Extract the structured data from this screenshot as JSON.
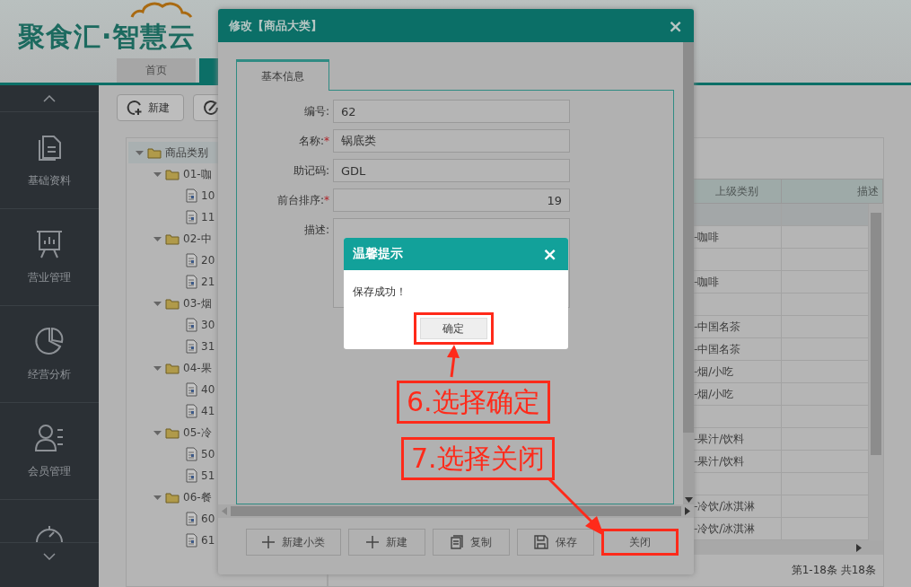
{
  "header": {
    "logo": "聚食汇·智慧云",
    "tabs": [
      {
        "label": "首页",
        "selected": false
      },
      {
        "selected": true
      }
    ]
  },
  "sidebar": {
    "items": [
      {
        "label": "基础资料",
        "kind": "files"
      },
      {
        "label": "营业管理",
        "kind": "board"
      },
      {
        "label": "经营分析",
        "kind": "pie"
      },
      {
        "label": "会员管理",
        "kind": "member"
      }
    ]
  },
  "toolbar": {
    "new_button": "新建"
  },
  "tree": {
    "label": "商品类别",
    "selected": true,
    "expanded": true,
    "children": [
      {
        "label": "01-咖",
        "selected": false,
        "expanded": true,
        "children": [
          {
            "label": "10",
            "selected": false
          },
          {
            "label": "11",
            "selected": false
          }
        ]
      },
      {
        "label": "02-中",
        "selected": false,
        "expanded": true,
        "children": [
          {
            "label": "20",
            "selected": false
          },
          {
            "label": "21",
            "selected": false
          }
        ]
      },
      {
        "label": "03-烟",
        "selected": false,
        "expanded": true,
        "children": [
          {
            "label": "30",
            "selected": false
          },
          {
            "label": "31",
            "selected": false
          }
        ]
      },
      {
        "label": "04-果",
        "selected": false,
        "expanded": true,
        "children": [
          {
            "label": "40",
            "selected": false
          },
          {
            "label": "41",
            "selected": false
          }
        ]
      },
      {
        "label": "05-冷",
        "selected": false,
        "expanded": true,
        "children": [
          {
            "label": "50",
            "selected": false
          },
          {
            "label": "51",
            "selected": false
          }
        ]
      },
      {
        "label": "06-餐",
        "selected": false,
        "expanded": true,
        "children": [
          {
            "label": "60",
            "selected": false
          },
          {
            "label": "61",
            "selected": false
          }
        ]
      }
    ]
  },
  "grid": {
    "columns": [
      "上级类别",
      "描述"
    ],
    "rows": [
      {
        "parent": "",
        "selected": true
      },
      {
        "parent": "-咖啡",
        "selected": false
      },
      {
        "parent": "",
        "selected": false
      },
      {
        "parent": "-咖啡",
        "selected": false
      },
      {
        "parent": "",
        "selected": false
      },
      {
        "parent": "-中国名茶",
        "selected": false
      },
      {
        "parent": "-中国名茶",
        "selected": false
      },
      {
        "parent": "-烟/小吃",
        "selected": false
      },
      {
        "parent": "-烟/小吃",
        "selected": false
      },
      {
        "parent": "",
        "selected": false
      },
      {
        "parent": "-果汁/饮料",
        "selected": false
      },
      {
        "parent": "-果汁/饮料",
        "selected": false
      },
      {
        "parent": "",
        "selected": false
      },
      {
        "parent": "-冷饮/冰淇淋",
        "selected": false
      },
      {
        "parent": "-冷饮/冰淇淋",
        "selected": false
      }
    ],
    "status": "第1-18条 共18条"
  },
  "edit_dialog": {
    "title": "修改【商品大类】",
    "close": "×",
    "tabs": [
      {
        "label": "基本信息",
        "selected": true
      }
    ],
    "required_mark": "*",
    "fields": [
      {
        "label": "编号:",
        "value": "62",
        "required": false,
        "kind": "text"
      },
      {
        "label": "名称:",
        "value": "锅底类",
        "required": true,
        "kind": "text"
      },
      {
        "label": "助记码:",
        "value": "GDL",
        "required": false,
        "kind": "text"
      },
      {
        "label": "前台排序:",
        "value": "19",
        "required": true,
        "kind": "number"
      },
      {
        "label": "描述:",
        "required": false,
        "kind": "textarea"
      }
    ],
    "buttons": [
      {
        "label": "新建小类",
        "kind": "plus",
        "highlighted": false
      },
      {
        "label": "新建",
        "kind": "plus",
        "highlighted": false
      },
      {
        "label": "复制",
        "kind": "copy",
        "highlighted": false
      },
      {
        "label": "保存",
        "kind": "save",
        "highlighted": false
      },
      {
        "label": "关闭",
        "kind": "none",
        "highlighted": true
      }
    ]
  },
  "alert": {
    "title": "温馨提示",
    "close": "×",
    "message": "保存成功！",
    "button": {
      "label": "确定",
      "highlighted": true
    }
  },
  "annotations": [
    {
      "text": "6.选择确定"
    },
    {
      "text": "7.选择关闭"
    }
  ]
}
